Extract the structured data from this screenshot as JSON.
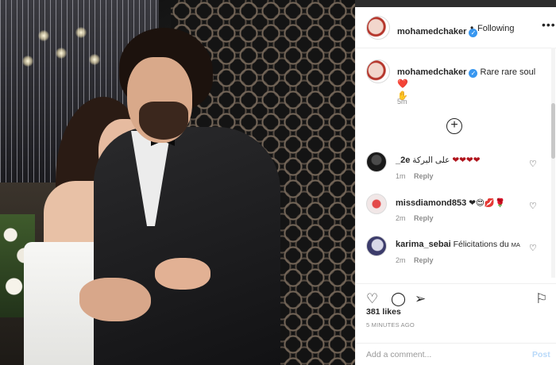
{
  "post": {
    "author": "mohamedchaker",
    "follow_separator": "•",
    "follow_status": "Following",
    "more_icon": "more-horizontal-icon",
    "caption": "Rare rare soul",
    "caption_emoji": "❤️",
    "caption_emoji2": "✋",
    "caption_time": "5m",
    "load_more_icon": "plus-circle-icon",
    "likes": "381 likes",
    "posted_time": "5 MINUTES AGO"
  },
  "comments": [
    {
      "user": "_2e",
      "text": "على البركة",
      "emoji": "❤❤❤❤",
      "time": "1m",
      "reply": "Reply"
    },
    {
      "user": "missdiamond853",
      "text": "",
      "emoji": "❤😍💋🌹",
      "time": "2m",
      "reply": "Reply"
    },
    {
      "user": "karima_sebai",
      "text": "Félicitations du",
      "suffix": "MA",
      "time": "2m",
      "reply": "Reply"
    }
  ],
  "actions": {
    "like_icon": "heart-icon",
    "comment_icon": "comment-icon",
    "share_icon": "send-icon",
    "save_icon": "bookmark-icon"
  },
  "composer": {
    "placeholder": "Add a comment...",
    "post_label": "Post"
  },
  "colors": {
    "verified": "#3897f0",
    "heart": "#b0141c",
    "post_disabled": "#b8d9f9"
  }
}
